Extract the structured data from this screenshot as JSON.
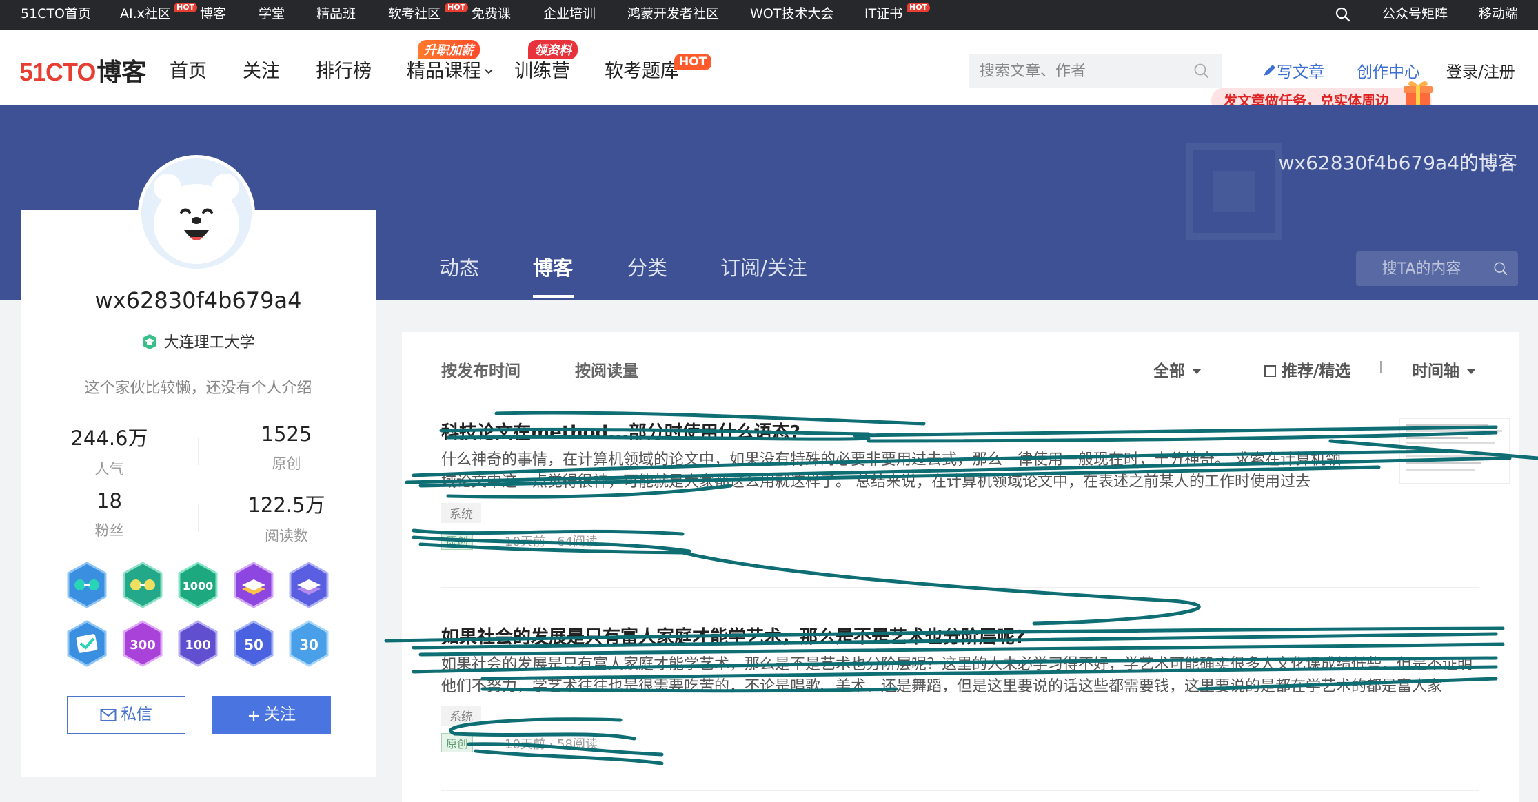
{
  "topbar": {
    "items": [
      "51CTO首页",
      "AI.x社区",
      "博客",
      "学堂",
      "精品班",
      "软考社区",
      "免费课",
      "企业培训",
      "鸿蒙开发者社区",
      "WOT技术大会",
      "IT证书"
    ],
    "hot_label": "HOT",
    "right": [
      "公众号矩阵",
      "移动端"
    ]
  },
  "header": {
    "logo": "51CTO",
    "logo_suffix": "博客",
    "nav": [
      "首页",
      "关注",
      "排行榜",
      "精品课程",
      "训练营",
      "软考题库"
    ],
    "badge_course": "升职加薪",
    "badge_camp": "领资料",
    "hot_label": "HOT",
    "search_placeholder": "搜索文章、作者",
    "write": "写文章",
    "creator": "创作中心",
    "login": "登录/注册",
    "promo": "发文章做任务，兑实体周边"
  },
  "banner": {
    "title": "wx62830f4b679a4的博客",
    "tabs": [
      "动态",
      "博客",
      "分类",
      "订阅/关注"
    ],
    "search_placeholder": "搜TA的内容"
  },
  "profile": {
    "username": "wx62830f4b679a4",
    "school": "大连理工大学",
    "bio": "这个家伙比较懒，还没有个人介绍",
    "stats": [
      {
        "num": "244.6万",
        "label": "人气"
      },
      {
        "num": "1525",
        "label": "原创"
      },
      {
        "num": "18",
        "label": "粉丝"
      },
      {
        "num": "122.5万",
        "label": "阅读数"
      }
    ],
    "badge_numbers": [
      "1000",
      "300",
      "100",
      "50",
      "30"
    ],
    "message_btn": "私信",
    "follow_btn": "关注"
  },
  "list": {
    "filter_time": "按发布时间",
    "filter_reads": "按阅读量",
    "filter_all": "全部",
    "filter_recommend": "推荐/精选",
    "filter_timeline": "时间轴",
    "articles": [
      {
        "title": "科技论文在method...部分时使用什么语态?",
        "summary": "什么神奇的事情，在计算机领域的论文中，如果没有特殊的必要非要用过去式，那么一律使用一般现在时，十分神奇。 求索在计算机领域论文中这一点觉得很神，可能就是大家都这么用就这样了。 总结来说，在计算机领域论文中，在表述之前某人的工作时使用过去",
        "tag": "系统",
        "original": "原创",
        "meta": "10天前 · 64阅读"
      },
      {
        "title": "如果社会的发展是只有富人家庭才能学艺术，那么是不是艺术也分阶层呢?",
        "summary": "如果社会的发展是只有富人家庭才能学艺术，那么是不是艺术也分阶层呢？这里的人未必学习得不好，学艺术可能确实很多人文化课成绩低些，但是不证明他们不努力，学艺术往往也是很需要吃苦的，不论是唱歌、美术、还是舞蹈，但是这里要说的话这些都需要钱，这里要说的是都在学艺术的都是富人家",
        "tag": "系统",
        "original": "原创",
        "meta": "10天前 · 58阅读"
      }
    ]
  },
  "colors": {
    "brand_red": "#e73e32",
    "banner_blue": "#3d5194",
    "link_blue": "#3b6fd4",
    "follow_blue": "#4a74e0",
    "scribble_teal": "#0e6e74"
  }
}
